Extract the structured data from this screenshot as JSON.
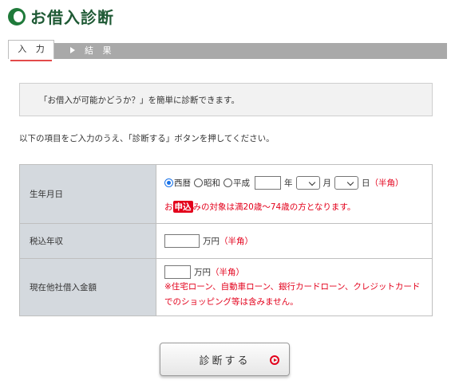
{
  "header": {
    "title": "お借入診断",
    "logo_icon": "green-circle-logo-icon"
  },
  "steps": [
    {
      "label": "入 力",
      "active": true
    },
    {
      "label": "結 果",
      "active": false
    }
  ],
  "info_text": "「お借入が可能かどうか？」を簡単に診断できます。",
  "intro_text": "以下の項目をご入力のうえ、「診断する」ボタンを押してください。",
  "form": {
    "birth": {
      "label": "生年月日",
      "eras": [
        "西暦",
        "昭和",
        "平成"
      ],
      "selected_era": "西暦",
      "year_value": "",
      "year_unit": "年",
      "month_value": "",
      "month_unit": "月",
      "day_value": "",
      "day_unit": "日",
      "hankaku": "（半角）",
      "note_prefix": "お",
      "note_stamp": "申込",
      "note_suffix": "みの対象は満20歳〜74歳の方となります。"
    },
    "income": {
      "label": "税込年収",
      "value": "",
      "unit": "万円",
      "hankaku": "（半角）"
    },
    "other_debt": {
      "label": "現在他社借入金額",
      "value": "",
      "unit": "万円",
      "hankaku": "（半角）",
      "warning_line1": "※住宅ローン、自動車ローン、銀行カードローン、クレジットカード",
      "warning_line2": "でのショッピング等は含みません。"
    }
  },
  "submit": {
    "label": "診断する",
    "icon": "red-circle-arrow-icon"
  },
  "colors": {
    "brand_green": "#1f7a3a",
    "accent_red": "#e3001b",
    "label_bg": "#d4d9de",
    "stepbar_gray": "#a9a9a9"
  }
}
